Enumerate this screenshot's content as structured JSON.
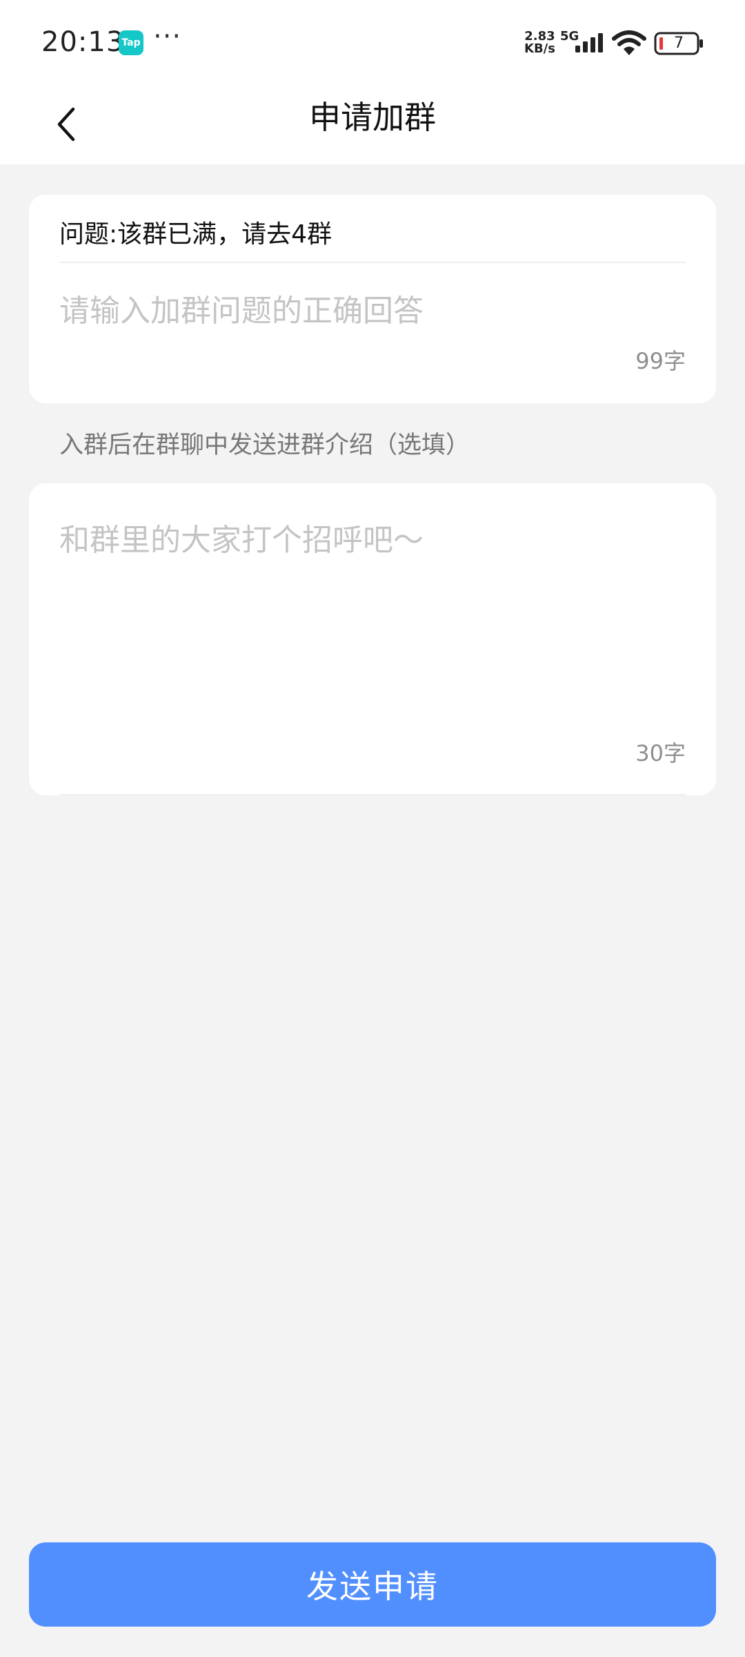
{
  "status_bar": {
    "time": "20:13",
    "app_badge": "Tap",
    "more_indicator": "···",
    "net_speed_value": "2.83",
    "net_speed_unit": "KB/s",
    "network_type": "5G",
    "battery_level": "7",
    "icons": [
      "tap-app-icon",
      "signal-icon",
      "wifi-icon",
      "battery-icon"
    ]
  },
  "header": {
    "title": "申请加群",
    "back_icon": "chevron-left-icon"
  },
  "question_card": {
    "question": "问题:该群已满，请去4群",
    "answer_placeholder": "请输入加群问题的正确回答",
    "answer_counter": "99字"
  },
  "intro_section": {
    "label": "入群后在群聊中发送进群介绍（选填）",
    "placeholder": "和群里的大家打个招呼吧～",
    "counter": "30字"
  },
  "submit": {
    "label": "发送申请"
  },
  "colors": {
    "page_background": "#f3f3f3",
    "card_background": "#ffffff",
    "primary_button": "#528ffe",
    "placeholder_text": "#c4c4c4",
    "secondary_text": "#8e8e8e",
    "tap_icon": "#15c7c7",
    "battery_low": "#e53935"
  }
}
